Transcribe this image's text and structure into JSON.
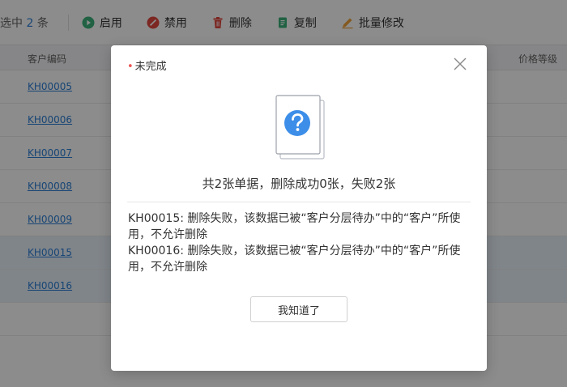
{
  "toolbar": {
    "selected_prefix": "选中",
    "selected_count": "2",
    "selected_suffix": "条",
    "enable": "启用",
    "disable": "禁用",
    "delete": "删除",
    "copy": "复制",
    "batch_edit": "批量修改"
  },
  "table": {
    "headers": {
      "code": "客户编码",
      "price_level": "价格等级"
    },
    "rows": [
      {
        "code": "KH00005",
        "selected": false
      },
      {
        "code": "KH00006",
        "selected": false
      },
      {
        "code": "KH00007",
        "selected": false
      },
      {
        "code": "KH00008",
        "selected": false
      },
      {
        "code": "KH00009",
        "selected": false
      },
      {
        "code": "KH00015",
        "selected": true
      },
      {
        "code": "KH00016",
        "selected": true
      }
    ]
  },
  "dialog": {
    "title_marker": "•",
    "title": "未完成",
    "summary": "共2张单据，删除成功0张，失败2张",
    "messages": [
      "KH00015: 删除失败，该数据已被“客户分层待办”中的“客户”所使用，不允许删除",
      "KH00016: 删除失败，该数据已被“客户分层待办”中的“客户”所使用，不允许删除"
    ],
    "ok_label": "我知道了"
  },
  "colors": {
    "link": "#2b7fd6",
    "enable_icon": "#3bb27b",
    "disable_icon": "#e2473f",
    "delete_icon": "#e2473f",
    "copy_icon": "#3bb27b",
    "batch_icon": "#f0a33a",
    "question_badge": "#3d8ee8"
  },
  "icons": {
    "enable": "play-circle-icon",
    "disable": "ban-icon",
    "delete": "trash-icon",
    "copy": "copy-icon",
    "batch_edit": "pencil-icon",
    "close": "close-icon",
    "doc": "document-question-icon"
  }
}
